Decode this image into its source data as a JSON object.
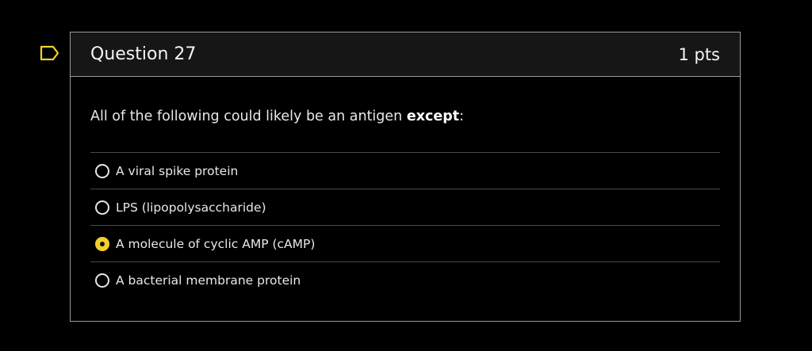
{
  "question": {
    "title": "Question 27",
    "points": "1 pts",
    "prompt_text": "All of the following could likely be an antigen ",
    "prompt_emphasis": "except",
    "prompt_end": ":"
  },
  "answers": [
    {
      "label": "A viral spike protein",
      "selected": false
    },
    {
      "label": "LPS (lipopolysaccharide)",
      "selected": false
    },
    {
      "label": "A molecule of cyclic AMP (cAMP)",
      "selected": true
    },
    {
      "label": "A bacterial membrane protein",
      "selected": false
    }
  ],
  "colors": {
    "background": "#000000",
    "selected_radio": "#f3cf2b",
    "border": "#9a9a9a"
  },
  "icons": {
    "bookmark": "bookmark-flag-icon"
  }
}
